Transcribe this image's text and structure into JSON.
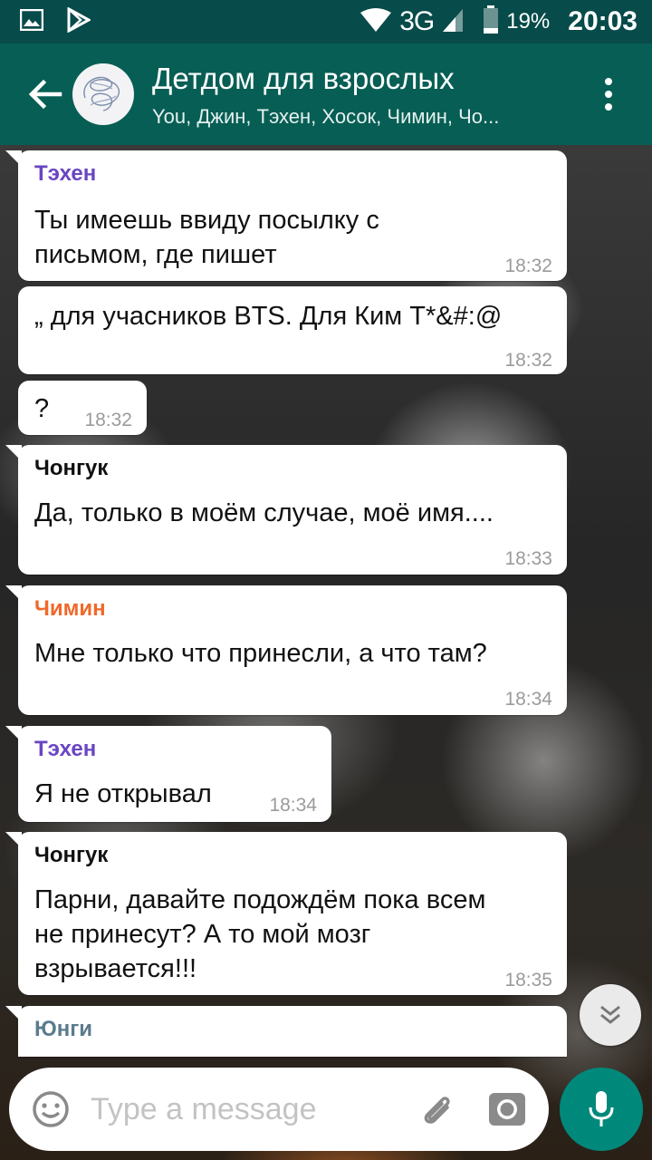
{
  "status_bar": {
    "network": "3G",
    "battery": "19%",
    "time": "20:03"
  },
  "header": {
    "title": "Детдом для взрослых",
    "subtitle": "You, Джин, Тэхен, Хосок, Чимин, Чо..."
  },
  "colors": {
    "appbar": "#075e54",
    "statusbar": "#074b4a",
    "taehyung": "#6a45c2",
    "jungkook": "#111111",
    "jimin": "#f0682a",
    "yoongi": "#5b7b8d",
    "mic": "#00897b"
  },
  "messages": [
    {
      "sender": "Тэхен",
      "text": "Ты имеешь ввиду посылку с письмом, где пишет",
      "time": "18:32"
    },
    {
      "sender": "",
      "text": "„ для учасников BTS. Для Ким Т*&#:@",
      "time": "18:32"
    },
    {
      "sender": "",
      "text": "?",
      "time": "18:32"
    },
    {
      "sender": "Чонгук",
      "text": "Да, только в моём случае, моё имя....",
      "time": "18:33"
    },
    {
      "sender": "Чимин",
      "text": "Мне только что принесли, а что там?",
      "time": "18:34"
    },
    {
      "sender": "Тэхен",
      "text": "Я не открывал",
      "time": "18:34"
    },
    {
      "sender": "Чонгук",
      "text": "Парни, давайте подождём пока всем не принесут? А то мой мозг взрывается!!!",
      "time": "18:35"
    },
    {
      "sender": "Юнги",
      "text": "",
      "time": ""
    }
  ],
  "input": {
    "placeholder": "Type a message"
  },
  "icons": [
    "image-icon",
    "play-store-icon",
    "wifi-icon",
    "signal-icon",
    "battery-icon",
    "back-arrow-icon",
    "menu-dots-icon",
    "chevron-double-down-icon",
    "emoji-icon",
    "attach-icon",
    "camera-icon",
    "mic-icon"
  ]
}
